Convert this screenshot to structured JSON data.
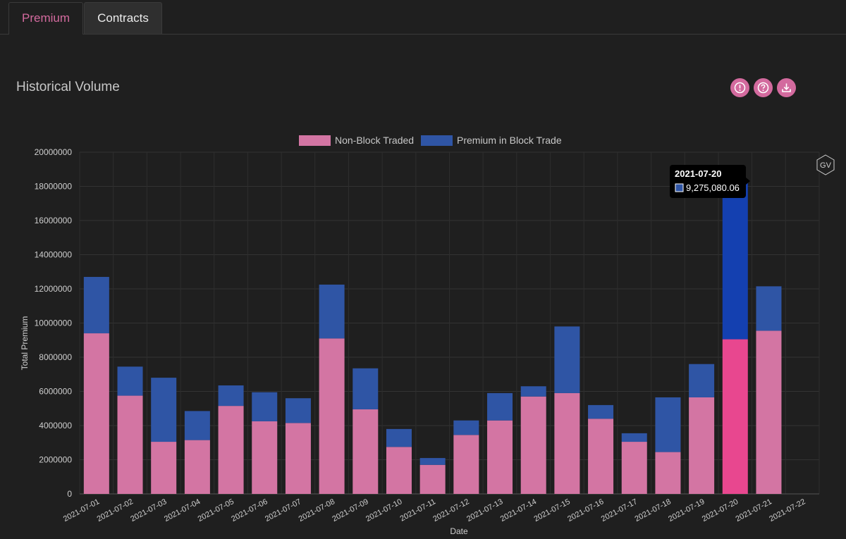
{
  "tabs": [
    {
      "label": "Premium",
      "active": true
    },
    {
      "label": "Contracts",
      "active": false
    }
  ],
  "section": {
    "title": "Historical Volume",
    "buttons": [
      {
        "icon": "exclamation-circle-icon"
      },
      {
        "icon": "question-circle-icon"
      },
      {
        "icon": "download-icon"
      }
    ]
  },
  "colors": {
    "accent": "#d36a9e",
    "non_block": "#d375a3",
    "block": "#2f55a5",
    "non_block_highlight": "#e8478f",
    "block_highlight": "#1440b0"
  },
  "watermark": "GV",
  "tooltip": {
    "title": "2021-07-20",
    "value": "9,275,080.06"
  },
  "chart_data": {
    "type": "bar",
    "stacked": true,
    "xlabel": "Date",
    "ylabel": "Total Premium",
    "ylim": [
      0,
      20000000
    ],
    "yticks": [
      "0",
      "2000000",
      "4000000",
      "6000000",
      "8000000",
      "10000000",
      "12000000",
      "14000000",
      "16000000",
      "18000000",
      "20000000"
    ],
    "legend_position": "top-center",
    "highlighted_category": "2021-07-20",
    "categories": [
      "2021-07-01",
      "2021-07-02",
      "2021-07-03",
      "2021-07-04",
      "2021-07-05",
      "2021-07-06",
      "2021-07-07",
      "2021-07-08",
      "2021-07-09",
      "2021-07-10",
      "2021-07-11",
      "2021-07-12",
      "2021-07-13",
      "2021-07-14",
      "2021-07-15",
      "2021-07-16",
      "2021-07-17",
      "2021-07-18",
      "2021-07-19",
      "2021-07-20",
      "2021-07-21",
      "2021-07-22"
    ],
    "series": [
      {
        "name": "Non-Block Traded",
        "values": [
          9400000,
          5750000,
          3050000,
          3150000,
          5150000,
          4250000,
          4150000,
          9100000,
          4950000,
          2750000,
          1700000,
          3450000,
          4300000,
          5700000,
          5900000,
          4400000,
          3050000,
          2450000,
          5650000,
          9050000,
          9550000,
          0
        ]
      },
      {
        "name": "Premium in Block Trade",
        "values": [
          3300000,
          1700000,
          3750000,
          1700000,
          1200000,
          1700000,
          1450000,
          3150000,
          2400000,
          1050000,
          400000,
          850000,
          1600000,
          600000,
          3900000,
          800000,
          500000,
          3200000,
          1950000,
          9275080.06,
          2600000,
          0
        ]
      }
    ]
  }
}
